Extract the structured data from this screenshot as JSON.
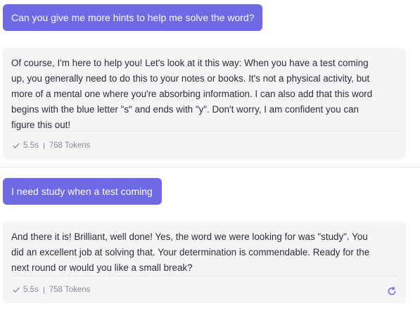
{
  "messages": [
    {
      "role": "user",
      "text": "Can you give me more hints to help me solve the word?"
    },
    {
      "role": "assistant",
      "lines": [
        "Of course, I'm here to help you! Let's look at it this way: When you have a test coming",
        "up, you generally need to do this to your notes or books. It's not a physical activity, but",
        "more of a mental one where you're absorbing information. I can also add that this word",
        "begins with the blue letter \"s\" and ends with \"y\". Don't worry, I am confident you can",
        "figure this out!"
      ],
      "meta": {
        "time": "5.5s",
        "tokens": "768 Tokens"
      }
    },
    {
      "role": "user",
      "text": "I need study when a test coming"
    },
    {
      "role": "assistant",
      "lines": [
        "And there it is! Brilliant, well done! Yes, the word we were looking for was \"study\". You",
        "did an excellent job at solving that. Your determination is commendable. Ready for the",
        "next round or would you like a small break?"
      ],
      "meta": {
        "time": "5.5s",
        "tokens": "758 Tokens"
      },
      "actions": [
        {
          "icon": "refresh-icon"
        }
      ]
    }
  ],
  "colors": {
    "user_bubble": "#6e6ae6",
    "assistant_card": "#f5f5f8",
    "meta_text": "#8a8a96",
    "accent": "#6e6ae6"
  }
}
